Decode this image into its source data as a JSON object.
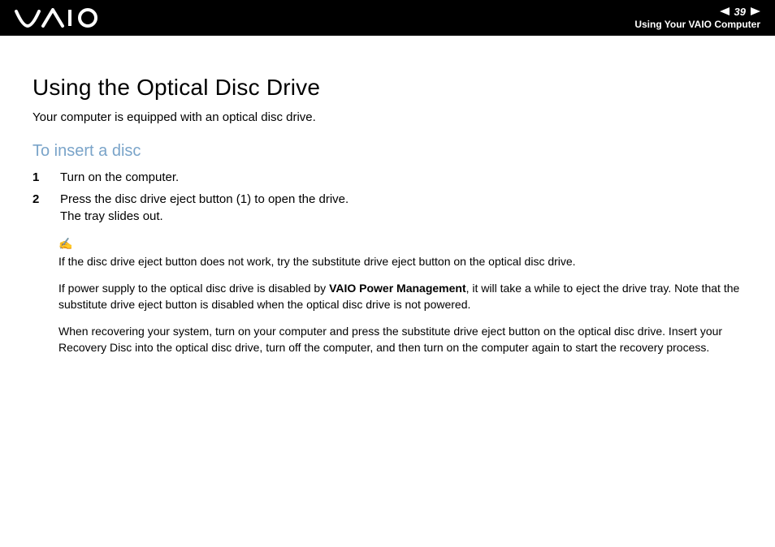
{
  "header": {
    "logo_alt": "VAIO",
    "page_number": "39",
    "breadcrumb": "Using Your VAIO Computer"
  },
  "title": "Using the Optical Disc Drive",
  "intro": "Your computer is equipped with an optical disc drive.",
  "section_title": "To insert a disc",
  "steps": [
    {
      "num": "1",
      "text": "Turn on the computer."
    },
    {
      "num": "2",
      "text_line1": "Press the disc drive eject button (1) to open the drive.",
      "text_line2": "The tray slides out."
    }
  ],
  "notes": {
    "icon": "✍",
    "para1": "If the disc drive eject button does not work, try the substitute drive eject button on the optical disc drive.",
    "para2_pre": "If power supply to the optical disc drive is disabled by ",
    "para2_bold": "VAIO Power Management",
    "para2_post": ", it will take a while to eject the drive tray. Note that the substitute drive eject button is disabled when the optical disc drive is not powered.",
    "para3": "When recovering your system, turn on your computer and press the substitute drive eject button on the optical disc drive. Insert your Recovery Disc into the optical disc drive, turn off the computer, and then turn on the computer again to start the recovery process."
  }
}
